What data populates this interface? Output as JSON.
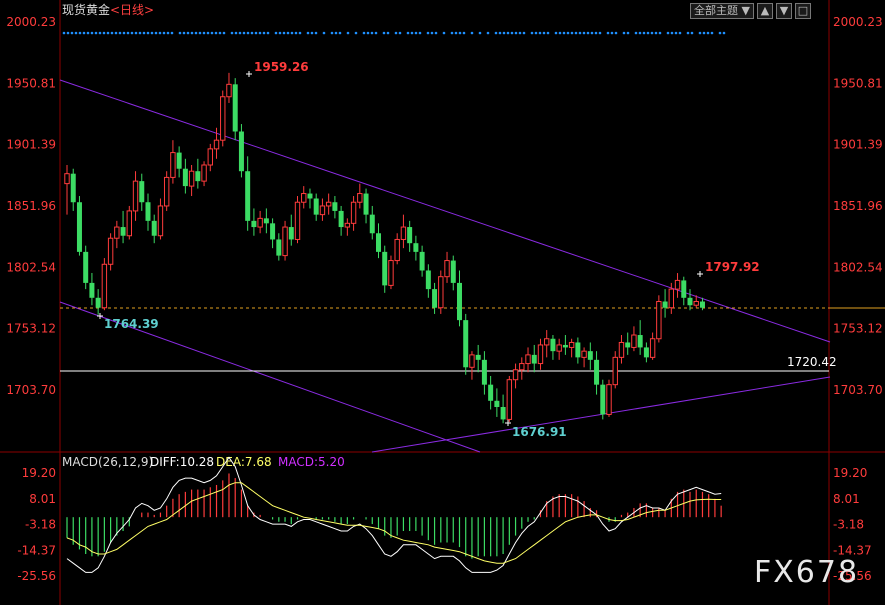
{
  "title": "现货黄金",
  "period": "<日线>",
  "toolbar": {
    "theme_select": "全部主题",
    "theme_arrow": "▼",
    "btn_up": "▲",
    "btn_down": "▼",
    "btn_box": "□"
  },
  "watermark": "FX678",
  "colors": {
    "up": "#ff3c3c",
    "down": "#3cdc64",
    "label": "#ff3c3c",
    "trend": "#8a2be2",
    "dots": "#1e90ff",
    "diff": "#ffffff",
    "dea": "#ffff66",
    "macd_text": "#d030ff"
  },
  "price_axis": {
    "ticks": [
      "2000.23",
      "1950.81",
      "1901.39",
      "1851.96",
      "1802.54",
      "1753.12",
      "1703.70"
    ],
    "right_ticks": [
      "2000.23",
      "1950.81",
      "1901.39",
      "1851.96",
      "1802.54",
      "1753.12",
      "1703.70"
    ],
    "ylim": [
      1657.0,
      2000.23
    ]
  },
  "annotations": {
    "high": "1959.26",
    "recent_high": "1797.92",
    "low_left": "1764.39",
    "low_right": "1676.91",
    "hline": "1720.42"
  },
  "macd": {
    "header": "MACD(26,12,9)",
    "diff_label": "DIFF:10.28",
    "dea_label": "DEA:7.68",
    "macd_label": "MACD:5.20",
    "ticks": [
      "19.20",
      "8.01",
      "-3.18",
      "-14.37",
      "-25.56"
    ],
    "right_ticks": [
      "19.20",
      "8.01",
      "-3.18",
      "-14.37",
      "-25.56"
    ],
    "ylim": [
      -28,
      23
    ]
  },
  "chart_data": {
    "type": "candlestick",
    "title": "现货黄金 <日线>",
    "candles": [
      [
        1870,
        1885,
        1878,
        1845
      ],
      [
        1878,
        1882,
        1855,
        1848
      ],
      [
        1855,
        1860,
        1815,
        1812
      ],
      [
        1815,
        1820,
        1790,
        1785
      ],
      [
        1790,
        1798,
        1778,
        1772
      ],
      [
        1778,
        1785,
        1770,
        1764.39
      ],
      [
        1770,
        1810,
        1805,
        1768
      ],
      [
        1805,
        1830,
        1826,
        1800
      ],
      [
        1826,
        1840,
        1835,
        1818
      ],
      [
        1835,
        1848,
        1828,
        1822
      ],
      [
        1828,
        1852,
        1848,
        1825
      ],
      [
        1848,
        1880,
        1872,
        1840
      ],
      [
        1872,
        1878,
        1855,
        1848
      ],
      [
        1855,
        1862,
        1840,
        1832
      ],
      [
        1840,
        1845,
        1828,
        1822
      ],
      [
        1828,
        1858,
        1852,
        1825
      ],
      [
        1852,
        1880,
        1875,
        1848
      ],
      [
        1875,
        1905,
        1895,
        1870
      ],
      [
        1895,
        1900,
        1882,
        1875
      ],
      [
        1882,
        1890,
        1868,
        1862
      ],
      [
        1868,
        1885,
        1880,
        1860
      ],
      [
        1880,
        1890,
        1872,
        1866
      ],
      [
        1872,
        1888,
        1885,
        1868
      ],
      [
        1885,
        1902,
        1898,
        1880
      ],
      [
        1898,
        1915,
        1905,
        1890
      ],
      [
        1905,
        1945,
        1940,
        1900
      ],
      [
        1940,
        1959.26,
        1950,
        1935
      ],
      [
        1950,
        1955,
        1912,
        1905
      ],
      [
        1912,
        1918,
        1880,
        1875
      ],
      [
        1880,
        1892,
        1840,
        1832
      ],
      [
        1840,
        1850,
        1835,
        1828
      ],
      [
        1835,
        1848,
        1842,
        1830
      ],
      [
        1842,
        1850,
        1838,
        1830
      ],
      [
        1838,
        1842,
        1825,
        1818
      ],
      [
        1825,
        1830,
        1812,
        1808
      ],
      [
        1812,
        1840,
        1835,
        1808
      ],
      [
        1835,
        1845,
        1825,
        1820
      ],
      [
        1825,
        1860,
        1855,
        1822
      ],
      [
        1855,
        1868,
        1862,
        1850
      ],
      [
        1862,
        1866,
        1858,
        1850
      ],
      [
        1858,
        1862,
        1845,
        1840
      ],
      [
        1845,
        1858,
        1852,
        1840
      ],
      [
        1852,
        1862,
        1855,
        1845
      ],
      [
        1855,
        1860,
        1848,
        1842
      ],
      [
        1848,
        1852,
        1835,
        1828
      ],
      [
        1835,
        1842,
        1838,
        1828
      ],
      [
        1838,
        1860,
        1855,
        1832
      ],
      [
        1855,
        1870,
        1862,
        1850
      ],
      [
        1862,
        1866,
        1845,
        1838
      ],
      [
        1845,
        1852,
        1830,
        1825
      ],
      [
        1830,
        1838,
        1815,
        1810
      ],
      [
        1815,
        1820,
        1788,
        1782
      ],
      [
        1788,
        1812,
        1808,
        1785
      ],
      [
        1808,
        1830,
        1825,
        1805
      ],
      [
        1825,
        1845,
        1835,
        1818
      ],
      [
        1835,
        1840,
        1822,
        1815
      ],
      [
        1822,
        1828,
        1815,
        1808
      ],
      [
        1815,
        1820,
        1800,
        1795
      ],
      [
        1800,
        1805,
        1785,
        1778
      ],
      [
        1785,
        1790,
        1770,
        1765
      ],
      [
        1770,
        1800,
        1795,
        1765
      ],
      [
        1795,
        1815,
        1808,
        1790
      ],
      [
        1808,
        1812,
        1790,
        1784
      ],
      [
        1790,
        1800,
        1760,
        1755
      ],
      [
        1760,
        1765,
        1722,
        1716
      ],
      [
        1722,
        1735,
        1732,
        1712
      ],
      [
        1732,
        1740,
        1728,
        1718
      ],
      [
        1728,
        1735,
        1708,
        1700
      ],
      [
        1708,
        1715,
        1695,
        1688
      ],
      [
        1695,
        1705,
        1690,
        1682
      ],
      [
        1690,
        1700,
        1680,
        1676.91
      ],
      [
        1680,
        1715,
        1712,
        1678
      ],
      [
        1712,
        1725,
        1720,
        1705
      ],
      [
        1720,
        1730,
        1725,
        1712
      ],
      [
        1725,
        1738,
        1732,
        1718
      ],
      [
        1732,
        1740,
        1725,
        1718
      ],
      [
        1725,
        1745,
        1740,
        1720
      ],
      [
        1740,
        1752,
        1745,
        1730
      ],
      [
        1745,
        1748,
        1735,
        1728
      ],
      [
        1735,
        1745,
        1740,
        1728
      ],
      [
        1740,
        1748,
        1738,
        1732
      ],
      [
        1738,
        1745,
        1742,
        1730
      ],
      [
        1742,
        1746,
        1730,
        1725
      ],
      [
        1730,
        1738,
        1735,
        1722
      ],
      [
        1735,
        1742,
        1728,
        1720
      ],
      [
        1728,
        1735,
        1708,
        1700
      ],
      [
        1708,
        1712,
        1684,
        1680
      ],
      [
        1684,
        1712,
        1708,
        1682
      ],
      [
        1708,
        1735,
        1730,
        1705
      ],
      [
        1730,
        1748,
        1742,
        1725
      ],
      [
        1742,
        1750,
        1738,
        1732
      ],
      [
        1738,
        1755,
        1748,
        1735
      ],
      [
        1748,
        1760,
        1738,
        1732
      ],
      [
        1738,
        1742,
        1730,
        1726
      ],
      [
        1730,
        1750,
        1745,
        1728
      ],
      [
        1745,
        1780,
        1775,
        1742
      ],
      [
        1775,
        1785,
        1770,
        1762
      ],
      [
        1770,
        1790,
        1785,
        1765
      ],
      [
        1785,
        1797.92,
        1792,
        1778
      ],
      [
        1792,
        1795,
        1778,
        1772
      ],
      [
        1778,
        1785,
        1772,
        1768
      ],
      [
        1772,
        1780,
        1775,
        1770
      ],
      [
        1775,
        1778,
        1770,
        1768
      ]
    ],
    "macd": [
      -9,
      -12,
      -14,
      -16,
      -17,
      -17,
      -15,
      -11,
      -8,
      -6,
      -4,
      0,
      2,
      2,
      1,
      2,
      5,
      8,
      10,
      11,
      12,
      12,
      12,
      13,
      14,
      16,
      19,
      17,
      12,
      5,
      2,
      1,
      0,
      -1,
      -2,
      -2,
      -3,
      -1,
      0,
      0,
      -1,
      -1,
      -1,
      -2,
      -3,
      -3,
      -1,
      0,
      -1,
      -3,
      -5,
      -8,
      -9,
      -8,
      -6,
      -6,
      -6,
      -8,
      -10,
      -12,
      -11,
      -11,
      -11,
      -13,
      -17,
      -18,
      -17,
      -17,
      -17,
      -17,
      -16,
      -12,
      -8,
      -5,
      -2,
      -1,
      3,
      7,
      9,
      10,
      10,
      10,
      9,
      7,
      4,
      3,
      0,
      -2,
      -2,
      1,
      2,
      4,
      6,
      6,
      4,
      4,
      3,
      8,
      11,
      12,
      11,
      12,
      11,
      10,
      8,
      5
    ],
    "diff": [
      -18,
      -20,
      -22,
      -24,
      -24,
      -22,
      -17,
      -11,
      -7,
      -4,
      -1,
      4,
      6,
      5,
      3,
      4,
      8,
      13,
      16,
      17,
      17,
      16,
      15,
      16,
      18,
      22,
      26,
      22,
      14,
      5,
      1,
      -1,
      -2,
      -3,
      -3,
      -3,
      -4,
      -2,
      -1,
      -1,
      -2,
      -3,
      -4,
      -5,
      -6,
      -6,
      -4,
      -3,
      -5,
      -8,
      -12,
      -16,
      -17,
      -15,
      -12,
      -12,
      -12,
      -14,
      -16,
      -18,
      -17,
      -17,
      -17,
      -19,
      -22,
      -24,
      -24,
      -24,
      -24,
      -23,
      -21,
      -16,
      -11,
      -7,
      -4,
      -2,
      2,
      6,
      8,
      9,
      9,
      8,
      7,
      5,
      3,
      1,
      -3,
      -6,
      -5,
      -2,
      0,
      2,
      4,
      5,
      4,
      4,
      3,
      7,
      10,
      11,
      12,
      13,
      12,
      11,
      10,
      10.28
    ],
    "dea": [
      -9,
      -10,
      -12,
      -13,
      -15,
      -16,
      -16,
      -15,
      -14,
      -12,
      -10,
      -8,
      -6,
      -4,
      -3,
      -2,
      -1,
      1,
      3,
      5,
      7,
      8,
      9,
      10,
      11,
      12,
      14,
      15,
      15,
      13,
      11,
      9,
      7,
      5,
      4,
      3,
      2,
      1,
      0,
      -0.5,
      -1,
      -1.5,
      -2,
      -2.5,
      -3,
      -3.5,
      -3.5,
      -3.5,
      -4,
      -4.5,
      -5,
      -6,
      -8,
      -9,
      -10,
      -10.5,
      -11,
      -11.5,
      -12,
      -13,
      -13.5,
      -14,
      -14.5,
      -15,
      -16,
      -17,
      -18,
      -19,
      -19.5,
      -20,
      -20,
      -19,
      -18,
      -16,
      -14,
      -12,
      -10,
      -8,
      -6,
      -4,
      -2,
      -1,
      0,
      0.5,
      1,
      1,
      0,
      -1,
      -1.5,
      -1.5,
      -1,
      0,
      1,
      2,
      2.5,
      3,
      3,
      4,
      5,
      6,
      7,
      7.5,
      7.7,
      7.8,
      7.7,
      7.68
    ],
    "ylim": [
      1657.0,
      2000.23
    ]
  }
}
